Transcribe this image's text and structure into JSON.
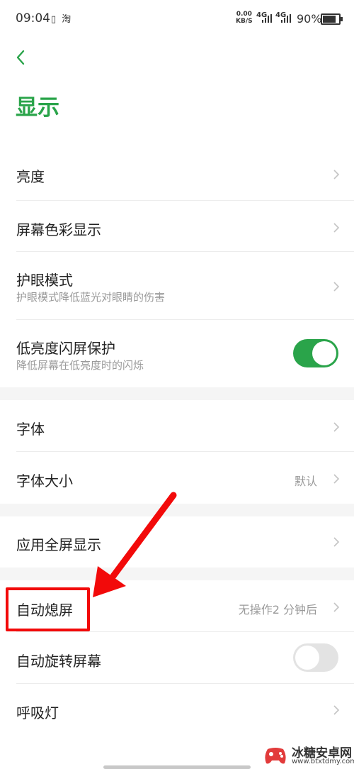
{
  "status_bar": {
    "time": "09:04",
    "left_icons": "▯ 淘",
    "net_speed_value": "0.00",
    "net_speed_unit": "KB/S",
    "signal_1": "4G",
    "signal_2": "4G",
    "battery_text": "90%",
    "battery_level": 0.9
  },
  "header": {
    "title": "显示"
  },
  "groups": {
    "g1": {
      "brightness": {
        "label": "亮度"
      },
      "screen_color": {
        "label": "屏幕色彩显示"
      },
      "eye_protection": {
        "label": "护眼模式",
        "subtitle": "护眼模式降低蓝光对眼睛的伤害"
      },
      "low_brightness_flicker": {
        "label": "低亮度闪屏保护",
        "subtitle": "降低屏幕在低亮度时的闪烁",
        "toggle_on": true
      }
    },
    "g2": {
      "font": {
        "label": "字体"
      },
      "font_size": {
        "label": "字体大小",
        "value": "默认"
      }
    },
    "g3": {
      "app_fullscreen": {
        "label": "应用全屏显示"
      }
    },
    "g4": {
      "auto_screen_off": {
        "label": "自动熄屏",
        "value": "无操作2 分钟后"
      },
      "auto_rotate": {
        "label": "自动旋转屏幕",
        "toggle_on": false
      },
      "breathing_light": {
        "label": "呼吸灯"
      }
    }
  },
  "annotation": {
    "color": "#f20a0a"
  },
  "colors": {
    "accent": "#2aa44a",
    "background": "#f5f5f5"
  },
  "watermark": {
    "title": "冰糖安卓网",
    "url": "www.btxtdmy.com"
  }
}
